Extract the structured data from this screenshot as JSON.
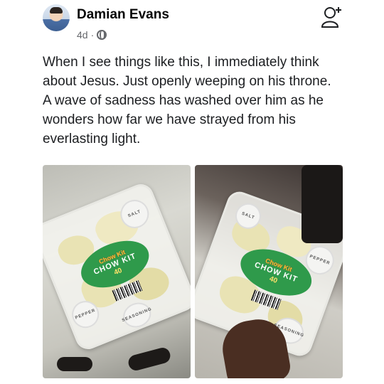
{
  "post": {
    "author": "Damian Evans",
    "time": "4d",
    "separator": "·",
    "text": "When I see things like this, I immediately think about Jesus. Just openly weeping on his throne. A wave of sadness has washed over him as he wonders how far we have strayed from his everlasting light."
  },
  "photos": [
    {
      "label_brand": "Chow Kit",
      "label_title": "CHOW KIT",
      "price": "40",
      "cup_labels": [
        "SALT",
        "PEPPER",
        "SEASONING"
      ]
    },
    {
      "label_brand": "Chow Kit",
      "label_title": "CHOW KIT",
      "price": "40",
      "cup_labels": [
        "SALT",
        "PEPPER",
        "SEASONING"
      ]
    }
  ],
  "icons": {
    "avatar": "profile-photo",
    "privacy": "globe-icon",
    "action": "add-friend-icon"
  },
  "colors": {
    "label_green": "#2f9a4b",
    "meta_gray": "#65676b"
  }
}
